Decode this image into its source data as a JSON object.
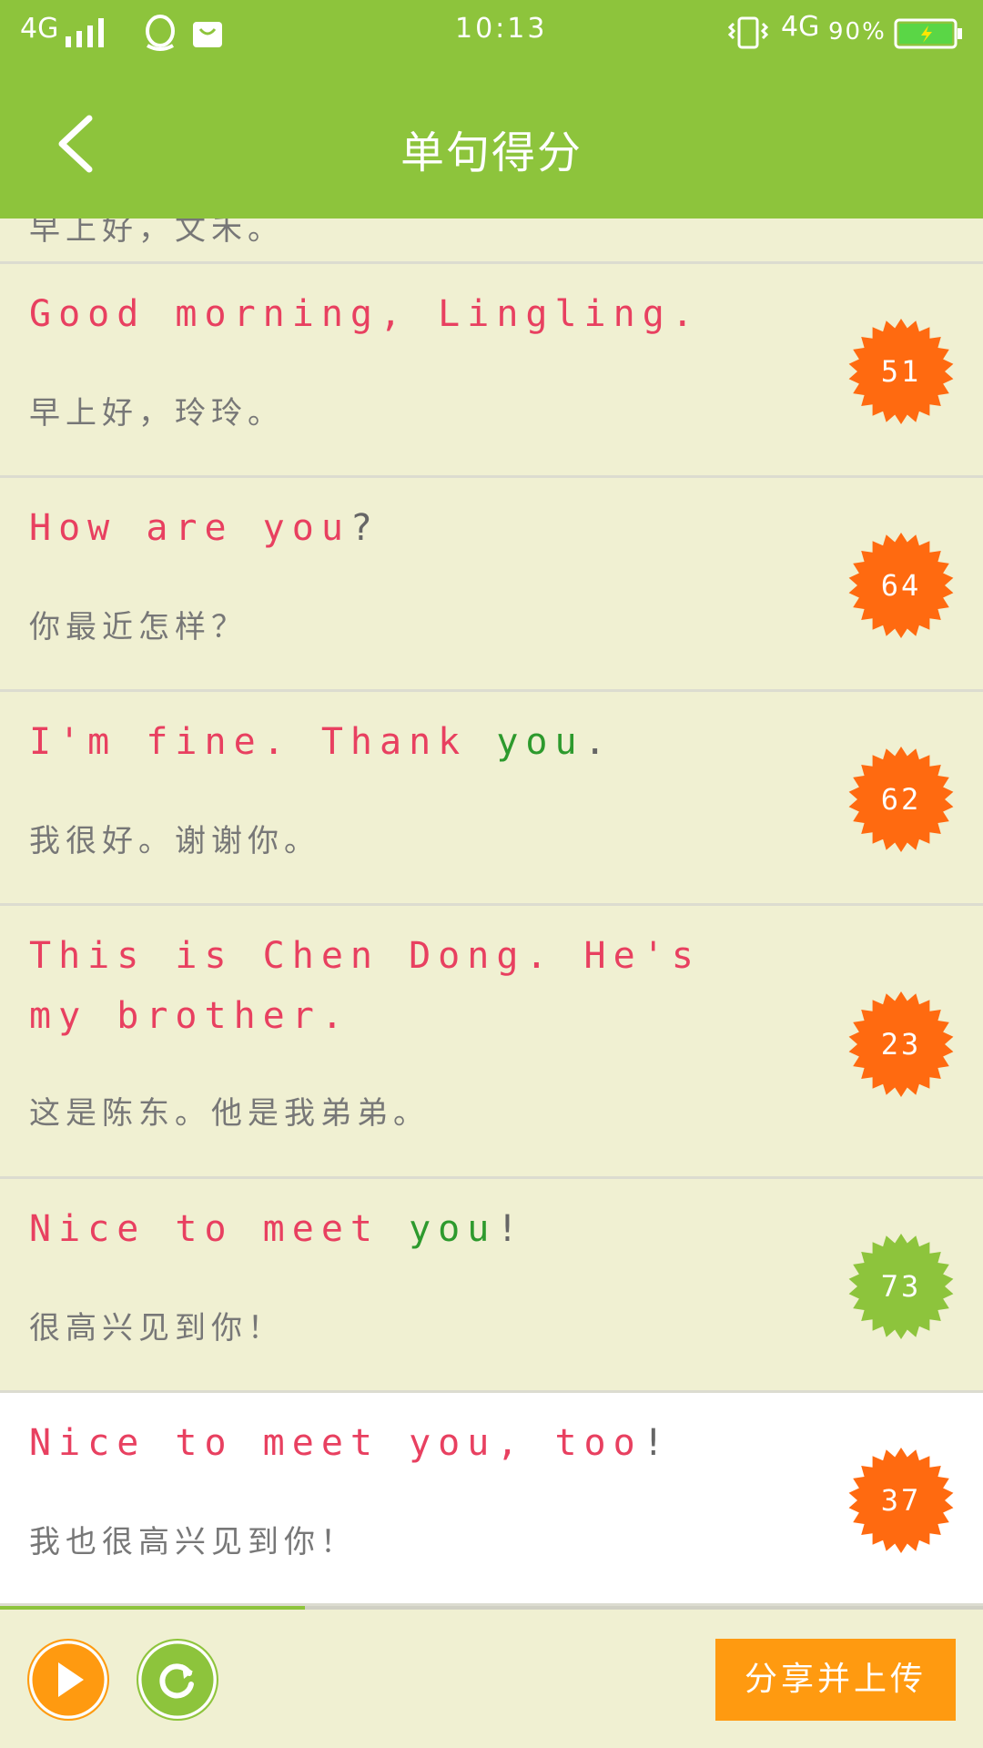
{
  "status_bar": {
    "network_left": "4G",
    "time": "10:13",
    "network_right": "4G",
    "battery": "90%"
  },
  "header": {
    "title": "单句得分",
    "back_icon": "chevron-left-icon"
  },
  "partial_row": {
    "zh": "早上好，文禾。"
  },
  "rows": [
    {
      "en": [
        {
          "t": "Good morning, Lingling.",
          "c": "r"
        }
      ],
      "zh": "早上好，玲玲。",
      "score": "51",
      "score_color": "#ff6a10"
    },
    {
      "en": [
        {
          "t": "How are you",
          "c": "r"
        },
        {
          "t": "?",
          "c": "k"
        }
      ],
      "zh": "你最近怎样？",
      "score": "64",
      "score_color": "#ff6a10"
    },
    {
      "en": [
        {
          "t": "I'm fine. Thank ",
          "c": "r"
        },
        {
          "t": "you",
          "c": "g"
        },
        {
          "t": ".",
          "c": "k"
        }
      ],
      "zh": "我很好。谢谢你。",
      "score": "62",
      "score_color": "#ff6a10"
    },
    {
      "en": [
        {
          "t": "This is Chen Dong. He's my brother.",
          "c": "r"
        }
      ],
      "zh": "这是陈东。他是我弟弟。",
      "score": "23",
      "score_color": "#ff6a10"
    },
    {
      "en": [
        {
          "t": "Nice to meet ",
          "c": "r"
        },
        {
          "t": "you",
          "c": "g"
        },
        {
          "t": "!",
          "c": "k"
        }
      ],
      "zh": "很高兴见到你！",
      "score": "73",
      "score_color": "#8dc43c"
    },
    {
      "en": [
        {
          "t": "Nice to meet you, too",
          "c": "r"
        },
        {
          "t": "!",
          "c": "k"
        }
      ],
      "zh": "我也很高兴见到你！",
      "score": "37",
      "score_color": "#ff6a10"
    }
  ],
  "bottom_bar": {
    "progress": 0.31,
    "play_icon": "play-icon",
    "replay_icon": "refresh-icon",
    "share_label": "分享并上传"
  },
  "colors": {
    "accent_green": "#8dc43c",
    "score_orange": "#ff6a10",
    "share_orange": "#ff9a10",
    "english_red": "#e84060",
    "english_green": "#2d9a2d"
  }
}
